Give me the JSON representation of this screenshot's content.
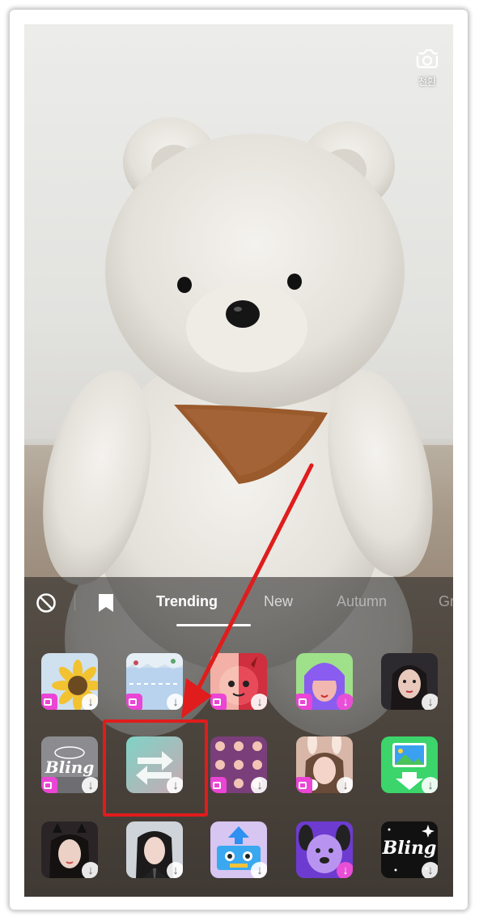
{
  "camera": {
    "switch_label": "전환"
  },
  "tabs": {
    "items": [
      {
        "label": "Trending",
        "active": true
      },
      {
        "label": "New"
      },
      {
        "label": "Autumn"
      },
      {
        "label": "Gr"
      }
    ]
  },
  "effects": {
    "row1": [
      "sunflower",
      "torn-paper",
      "half-face",
      "split-hair",
      "portrait"
    ],
    "row2": [
      "bling",
      "switch-arrows",
      "photo-grid",
      "bunny-ears",
      "photo-download"
    ],
    "row3": [
      "portrait-cat",
      "portrait-school",
      "upload-creature",
      "purple-dog",
      "bling-sparkle"
    ],
    "bling_label": "Bling"
  },
  "colors": {
    "accent_red": "#e01c1c",
    "download_pink": "#e84fd6"
  }
}
